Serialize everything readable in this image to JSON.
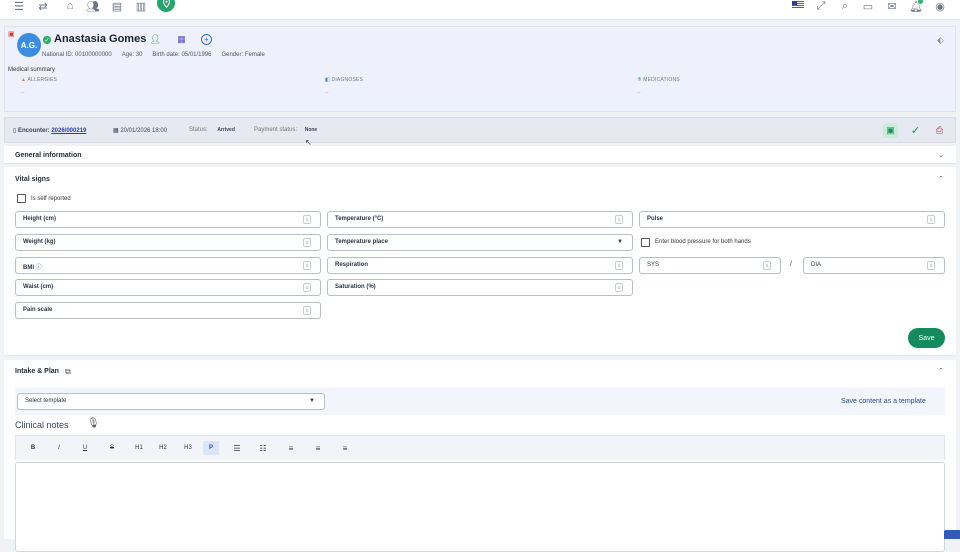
{
  "topbar": {
    "icons": [
      "menu-icon",
      "swap-icon",
      "home-icon",
      "users-icon",
      "inbox-tray-icon",
      "chart-icon",
      "location-pin-icon",
      "us-flag-icon",
      "fullscreen-icon",
      "search-icon",
      "inbox-icon",
      "mail-icon",
      "bell-icon",
      "user-circle-icon"
    ]
  },
  "patient": {
    "initials": "A.G.",
    "name": "Anastasia Gomes",
    "national_id": "National ID: 00100000000",
    "age": "Age: 30",
    "birth_date": "Birth date: 05/01/1996",
    "gender": "Gender: Female",
    "medical_summary_title": "Medical summary",
    "allergies": {
      "label": "ALLERGIES",
      "value": "--"
    },
    "diagnoses": {
      "label": "DIAGNOSES",
      "value": "--"
    },
    "medications": {
      "label": "MEDICATIONS",
      "value": "--"
    }
  },
  "encounter": {
    "label": "Encounter:",
    "number": "2026/000219",
    "datetime": "20/01/2026 18:00",
    "status_label": "Status:",
    "status_value": "Arrived",
    "payment_label": "Payment status:",
    "payment_value": "None"
  },
  "general_info": {
    "title": "General information"
  },
  "vitals": {
    "title": "Vital signs",
    "self_reported": "Is self reported",
    "height": "Height (cm)",
    "temperature": "Temperature (°C)",
    "pulse": "Pulse",
    "weight": "Weight (kg)",
    "temperature_place": "Temperature place",
    "bp_both_hands": "Enter blood pressure for both hands",
    "bmi": "BMI",
    "respiration": "Respiration",
    "sys": "SYS",
    "slash": "/",
    "dia": "DIA",
    "waist": "Waist (cm)",
    "saturation": "Saturation (%)",
    "pain_scale": "Pain scale",
    "save": "Save"
  },
  "intake": {
    "title": "Intake & Plan",
    "template_select": "Select template",
    "save_template": "Save content as a template",
    "clinical_notes": "Clinical notes",
    "toolbar": {
      "bold": "B",
      "italic": "I",
      "underline": "U",
      "strike": "S",
      "h1": "H1",
      "h2": "H2",
      "h3": "H3",
      "p": "P"
    }
  },
  "colors": {
    "accent_green": "#27a36b",
    "avatar_blue": "#3b8de0",
    "save_green": "#158a5e"
  }
}
